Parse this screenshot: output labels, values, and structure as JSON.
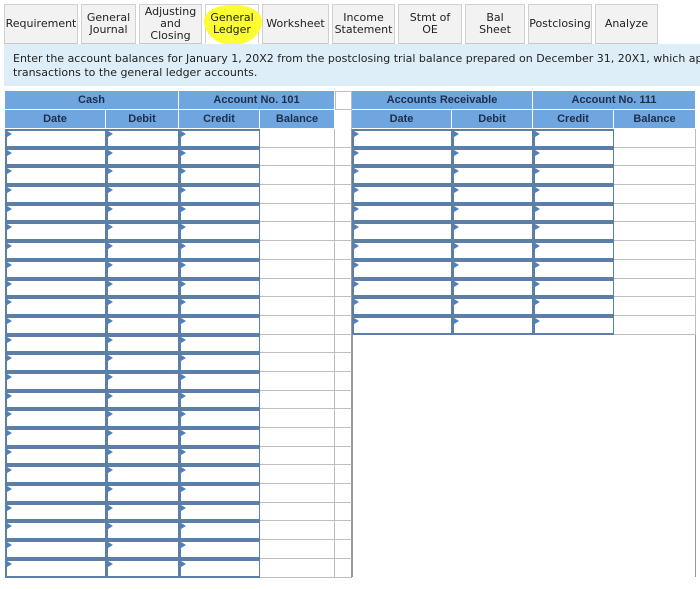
{
  "tabs": [
    {
      "label": "Requirement",
      "active": false
    },
    {
      "label": "General\nJournal",
      "active": false
    },
    {
      "label": "Adjusting\nand Closing",
      "active": false
    },
    {
      "label": "General\nLedger",
      "active": true
    },
    {
      "label": "Worksheet",
      "active": false
    },
    {
      "label": "Income\nStatement",
      "active": false
    },
    {
      "label": "Stmt of OE",
      "active": false
    },
    {
      "label": "Bal Sheet",
      "active": false
    },
    {
      "label": "Postclosing",
      "active": false
    },
    {
      "label": "Analyze",
      "active": false
    }
  ],
  "instructions": {
    "line1": "Enter the account balances for January 1, 20X2 from the postclosing trial balance prepared on December 31, 20X1, which appea",
    "line2": "transactions to the general ledger accounts."
  },
  "ledgers": [
    {
      "account_name": "Cash",
      "account_number": "Account No. 101",
      "columns": [
        "Date",
        "Debit",
        "Credit",
        "Balance"
      ],
      "row_count": 24
    },
    {
      "account_name": "Accounts Receivable",
      "account_number": "Account No. 111",
      "columns": [
        "Date",
        "Debit",
        "Credit",
        "Balance"
      ],
      "row_count": 11
    }
  ],
  "colors": {
    "header_bg": "#6fa6e0",
    "input_border": "#5b7fa6",
    "highlight": "#fcfc32",
    "instruction_bg": "#deeef9"
  }
}
